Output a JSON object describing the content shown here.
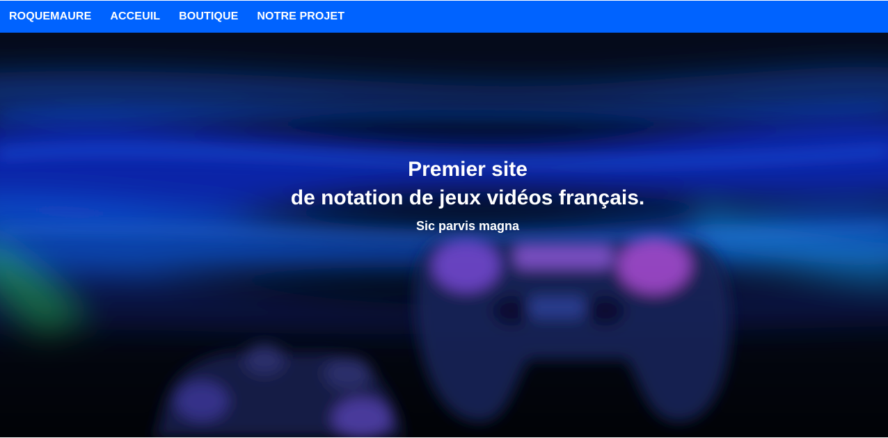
{
  "navbar": {
    "brand": "ROQUEMAURE",
    "links": [
      "ACCEUIL",
      "BOUTIQUE",
      "NOTRE PROJET"
    ],
    "background": "#0063ff"
  },
  "hero": {
    "title_line1": "Premier site",
    "title_line2": "de notation de jeux vidéos français.",
    "subtitle": "Sic parvis magna",
    "background_description_colors": [
      "#0a2fd6",
      "#1a8cff",
      "#2ec26a",
      "#9b4bff"
    ]
  }
}
